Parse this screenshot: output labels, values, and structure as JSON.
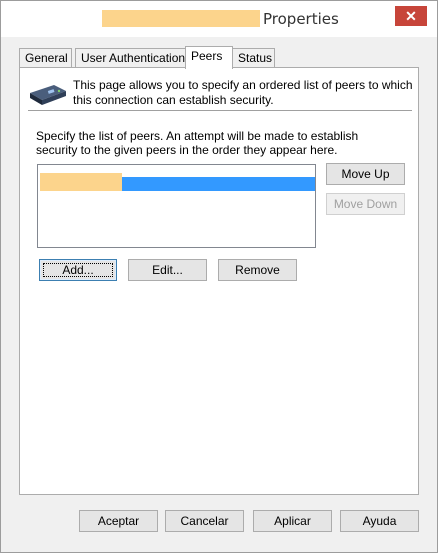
{
  "window": {
    "title": "Properties",
    "close_label": "✕"
  },
  "tabs": [
    {
      "label": "General"
    },
    {
      "label": "User Authentication"
    },
    {
      "label": "Peers"
    },
    {
      "label": "Status"
    }
  ],
  "peers_page": {
    "intro_text": "This page allows you to specify an ordered list of peers to which this connection can establish security.",
    "instruction_text": "Specify the list of peers. An attempt will be made to establish security to the given peers in the order they appear here.",
    "move_up_label": "Move Up",
    "move_down_label": "Move Down",
    "add_label": "Add...",
    "edit_label": "Edit...",
    "remove_label": "Remove"
  },
  "footer": {
    "accept_label": "Aceptar",
    "cancel_label": "Cancelar",
    "apply_label": "Aplicar",
    "help_label": "Ayuda"
  },
  "colors": {
    "selection": "#3399ff",
    "redaction": "#fcd48c",
    "close_button": "#c7453a"
  }
}
